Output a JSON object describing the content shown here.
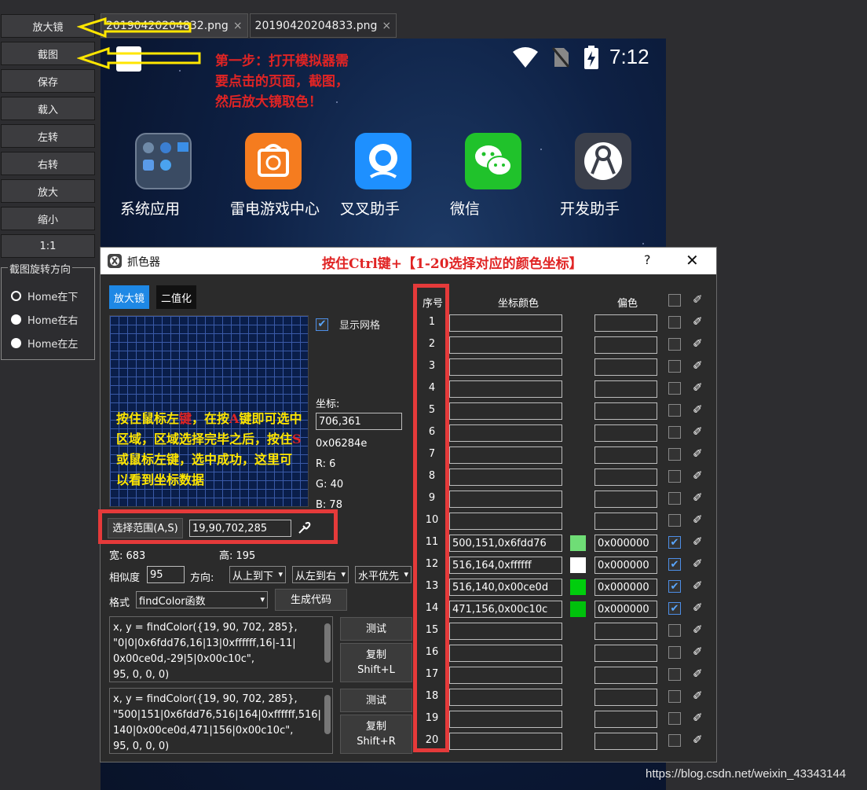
{
  "toolbar": {
    "buttons": [
      "放大镜",
      "截图",
      "保存",
      "载入",
      "左转",
      "右转",
      "放大",
      "缩小",
      "1:1"
    ],
    "rotation_group": {
      "title": "截图旋转方向",
      "options": [
        "Home在下",
        "Home在右",
        "Home在左"
      ],
      "selected": "Home在下"
    }
  },
  "tabs": [
    {
      "label": "20190420204832.png",
      "close": "×"
    },
    {
      "label": "20190420204833.png",
      "close": "×"
    }
  ],
  "emulator": {
    "time": "7:12",
    "apps": [
      "系统应用",
      "雷电游戏中心",
      "叉叉助手",
      "微信",
      "开发助手"
    ]
  },
  "annotations": {
    "step1": [
      "第一步：打开模拟器需",
      "要点击的页面，截图，",
      "然后放大镜取色！"
    ],
    "title_note": "按住Ctrl键+【1-20选择对应的颜色坐标】",
    "grid_note_parts": [
      "按住鼠标左",
      "键",
      "，在按",
      "A",
      "键即可选中区域，区域选择完毕之后，按住",
      "S",
      "或鼠标左键，选中成功，这里可以看到坐标数据"
    ]
  },
  "picker": {
    "title": "抓色器",
    "help": "?",
    "close": "✕",
    "modes": [
      "放大镜",
      "二值化"
    ],
    "show_grid_label": "显示网格",
    "coord_label": "坐标:",
    "coord_value": "706,361",
    "hex": "0x06284e",
    "r": "R:  6",
    "g": "G:  40",
    "b": "B:  78",
    "select_range_btn": "选择范围(A,S)",
    "select_range_value": "19,90,702,285",
    "width_label": "宽: 683",
    "height_label": "高: 195",
    "similarity_label": "相似度",
    "similarity_value": "95",
    "direction_label": "方向:",
    "dir1": "从上到下",
    "dir2": "从左到右",
    "dir3": "水平优先",
    "format_label": "格式",
    "format_value": "findColor函数",
    "generate_btn": "生成代码",
    "code1": [
      "x, y = findColor({19, 90, 702, 285},",
      "\"0|0|0x6fdd76,16|13|0xffffff,16|-11|",
      "0x00ce0d,-29|5|0x00c10c\",",
      "95, 0, 0, 0)"
    ],
    "code2": [
      "x, y = findColor({19, 90, 702, 285},",
      "\"500|151|0x6fdd76,516|164|0xffffff,516|",
      "140|0x00ce0d,471|156|0x00c10c\",",
      "95, 0, 0, 0)"
    ],
    "test_btn": "测试",
    "copy_l": [
      "复制",
      "Shift+L"
    ],
    "copy_r": [
      "复制",
      "Shift+R"
    ]
  },
  "table": {
    "headers": {
      "index": "序号",
      "coord_color": "坐标颜色",
      "offset": "偏色"
    },
    "rows": [
      {
        "n": "1",
        "coord": "",
        "offset": "",
        "color": "",
        "checked": false
      },
      {
        "n": "2",
        "coord": "",
        "offset": "",
        "color": "",
        "checked": false
      },
      {
        "n": "3",
        "coord": "",
        "offset": "",
        "color": "",
        "checked": false
      },
      {
        "n": "4",
        "coord": "",
        "offset": "",
        "color": "",
        "checked": false
      },
      {
        "n": "5",
        "coord": "",
        "offset": "",
        "color": "",
        "checked": false
      },
      {
        "n": "6",
        "coord": "",
        "offset": "",
        "color": "",
        "checked": false
      },
      {
        "n": "7",
        "coord": "",
        "offset": "",
        "color": "",
        "checked": false
      },
      {
        "n": "8",
        "coord": "",
        "offset": "",
        "color": "",
        "checked": false
      },
      {
        "n": "9",
        "coord": "",
        "offset": "",
        "color": "",
        "checked": false
      },
      {
        "n": "10",
        "coord": "",
        "offset": "",
        "color": "",
        "checked": false
      },
      {
        "n": "11",
        "coord": "500,151,0x6fdd76",
        "offset": "0x000000",
        "color": "#6fdd76",
        "checked": true
      },
      {
        "n": "12",
        "coord": "516,164,0xffffff",
        "offset": "0x000000",
        "color": "#ffffff",
        "checked": true
      },
      {
        "n": "13",
        "coord": "516,140,0x00ce0d",
        "offset": "0x000000",
        "color": "#00ce0d",
        "checked": true
      },
      {
        "n": "14",
        "coord": "471,156,0x00c10c",
        "offset": "0x000000",
        "color": "#00c10c",
        "checked": true
      },
      {
        "n": "15",
        "coord": "",
        "offset": "",
        "color": "",
        "checked": false
      },
      {
        "n": "16",
        "coord": "",
        "offset": "",
        "color": "",
        "checked": false
      },
      {
        "n": "17",
        "coord": "",
        "offset": "",
        "color": "",
        "checked": false
      },
      {
        "n": "18",
        "coord": "",
        "offset": "",
        "color": "",
        "checked": false
      },
      {
        "n": "19",
        "coord": "",
        "offset": "",
        "color": "",
        "checked": false
      },
      {
        "n": "20",
        "coord": "",
        "offset": "",
        "color": "",
        "checked": false
      }
    ]
  },
  "watermark": "https://blog.csdn.net/weixin_43343144",
  "colors": {
    "accent": "#1e88e5",
    "annotation_red": "#e53a3a",
    "annotation_yellow": "#ffe600"
  }
}
